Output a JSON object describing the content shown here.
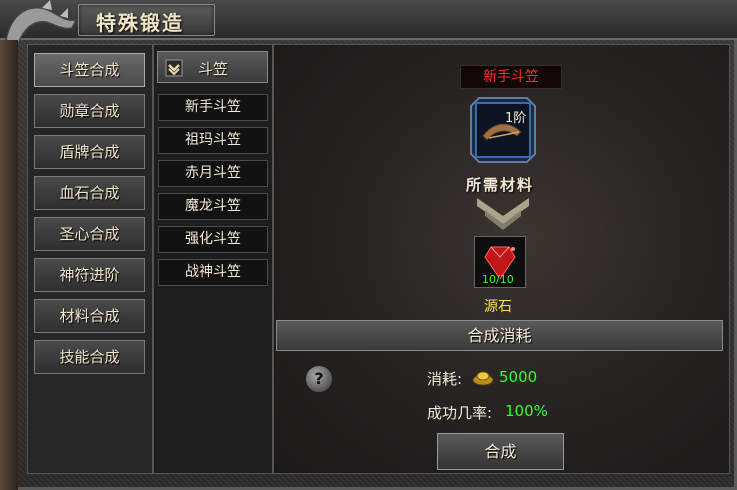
{
  "window": {
    "title": "特殊锻造"
  },
  "categories": [
    {
      "label": "斗笠合成",
      "active": true
    },
    {
      "label": "勋章合成"
    },
    {
      "label": "盾牌合成"
    },
    {
      "label": "血石合成"
    },
    {
      "label": "圣心合成"
    },
    {
      "label": "神符进阶"
    },
    {
      "label": "材料合成"
    },
    {
      "label": "技能合成"
    }
  ],
  "subpanel": {
    "header": "斗笠",
    "items": [
      "新手斗笠",
      "祖玛斗笠",
      "赤月斗笠",
      "魔龙斗笠",
      "强化斗笠",
      "战神斗笠"
    ]
  },
  "detail": {
    "item_name": "新手斗笠",
    "item_tier": "1阶",
    "materials_label": "所需材料",
    "material": {
      "name": "源石",
      "count": "10/10",
      "icon": "red-gem-icon"
    }
  },
  "cost": {
    "bar_label": "合成消耗",
    "cost_label": "消耗:",
    "cost_value": "5000",
    "rate_label": "成功几率:",
    "rate_value": "100%",
    "craft_label": "合成",
    "help_glyph": "?"
  },
  "colors": {
    "item_name": "#ff2a2a",
    "value_green": "#33ff33",
    "material_name": "#ffe14a"
  }
}
